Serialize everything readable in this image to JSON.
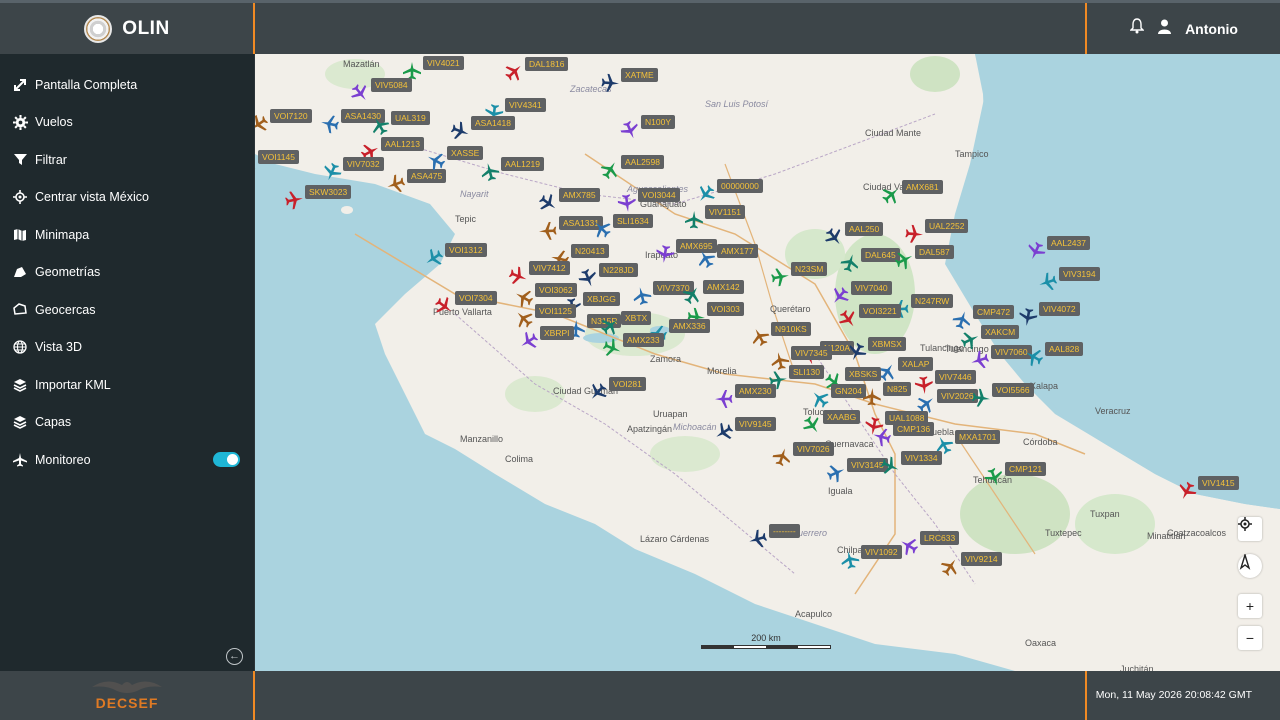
{
  "app": {
    "name": "OLIN",
    "footer_brand": "DECSEF"
  },
  "user": {
    "name": "Antonio"
  },
  "status": {
    "datetime": "Mon, 11 May 2026 20:08:42 GMT"
  },
  "sidebar": {
    "items": [
      {
        "label": "Pantalla Completa",
        "icon": "expand-icon"
      },
      {
        "label": "Vuelos",
        "icon": "gear-icon"
      },
      {
        "label": "Filtrar",
        "icon": "filter-icon"
      },
      {
        "label": "Centrar vista México",
        "icon": "crosshair-icon"
      },
      {
        "label": "Minimapa",
        "icon": "minimap-icon"
      },
      {
        "label": "Geometrías",
        "icon": "shape-icon"
      },
      {
        "label": "Geocercas",
        "icon": "geofence-icon"
      },
      {
        "label": "Vista 3D",
        "icon": "globe-icon"
      },
      {
        "label": "Importar KML",
        "icon": "layers-icon"
      },
      {
        "label": "Capas",
        "icon": "layers-icon"
      },
      {
        "label": "Monitoreo",
        "icon": "plane-icon",
        "toggle_on": true
      }
    ]
  },
  "map": {
    "scale_label": "200 km",
    "places": [
      "Zacatecas",
      "San Luis Potosí",
      "Aguascalientes",
      "Tepic",
      "Nayarit",
      "Puerto Vallarta",
      "Ciudad Guzmán",
      "Manzanillo",
      "Colima",
      "Zamora",
      "Morelia",
      "Michoacán",
      "Uruapan",
      "Apatzingán",
      "Lázaro Cárdenas",
      "Querétaro",
      "Toluca",
      "Cuernavaca",
      "Iguala",
      "Guerrero",
      "Chilpancingo",
      "Acapulco",
      "Oaxaca",
      "Puebla",
      "Veracruz",
      "Córdoba",
      "Tehuacán",
      "Tuxpan",
      "Ciudad Valles",
      "Ciudad Mante",
      "Tampico",
      "Tulancingo",
      "Xalapa",
      "Tuxtepec",
      "Coatzacoalcos",
      "Minatitlán",
      "Juchitán",
      "Mazatlán",
      "Guanajuato",
      "Irapuato",
      "Tulancingo"
    ],
    "flights": [
      "VIV4021",
      "DAL1816",
      "XATME",
      "VIV5084",
      "VIV4341",
      "VOI7120",
      "ASA1430",
      "UAL319",
      "VOI1145",
      "AAL1213",
      "ASA1418",
      "N100Y",
      "VIV7032",
      "ASA475",
      "XASSE",
      "AAL1219",
      "AAL2598",
      "SKW3023",
      "AMX785",
      "VOI3044",
      "00000000",
      "ASA1331",
      "SLI1634",
      "VIV1151",
      "AMX681",
      "UAL2252",
      "AAL250",
      "AMX695",
      "VOI1312",
      "N20413",
      "AMX177",
      "DAL645",
      "DAL587",
      "VIV7412",
      "N228JD",
      "AAL2437",
      "VIV3194",
      "VOI3062",
      "VIV7370",
      "AMX142",
      "N23SM",
      "VOI7304",
      "XBJGG",
      "VIV7040",
      "N247RW",
      "VOI1125",
      "N315R",
      "XBTX",
      "VOI303",
      "VOI3221",
      "VIV4072",
      "XBRPI",
      "AMX336",
      "N910KS",
      "CMP472",
      "XAKCM",
      "AMX233",
      "N120A",
      "XBMSX",
      "VIV7060",
      "AAL828",
      "VIV7345",
      "XALAP",
      "SLI130",
      "XBSKS",
      "VIV7446",
      "VOI281",
      "AMX230",
      "GN204",
      "N825",
      "VIV2026",
      "VOI5566",
      "XAABG",
      "UAL1088",
      "VIV9145",
      "CMP136",
      "MXA1701",
      "VIV7026",
      "VIV3145",
      "VIV1334",
      "CMP121",
      "VIV1415",
      "--------",
      "LRC633",
      "VIV1092",
      "VIV9214"
    ]
  },
  "controls": {
    "zoom_in": "+",
    "zoom_out": "−"
  },
  "colors": {
    "accent_orange": "#f08a24",
    "flight_label_text": "#f5c23a",
    "toggle": "#1fb6d6"
  }
}
